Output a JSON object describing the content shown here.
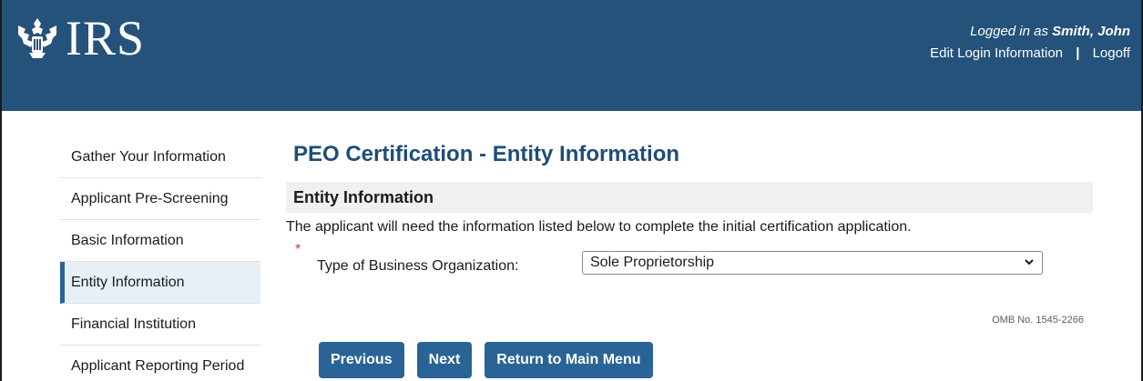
{
  "header": {
    "logo_text": "IRS",
    "logged_in_prefix": "Logged in as ",
    "user_name": "Smith, John",
    "edit_login_link": "Edit Login Information",
    "separator": "|",
    "logoff_link": "Logoff",
    "background_color": "#24527a"
  },
  "sidebar": {
    "items": [
      {
        "label": "Gather Your Information"
      },
      {
        "label": "Applicant Pre-Screening"
      },
      {
        "label": "Basic Information"
      },
      {
        "label": "Entity Information",
        "active": true
      },
      {
        "label": "Financial Institution"
      },
      {
        "label": "Applicant Reporting Period"
      }
    ]
  },
  "main": {
    "page_title": "PEO Certification - Entity Information",
    "section_title": "Entity Information",
    "intro_text": "The applicant will need the information listed below to complete the initial certification application.",
    "required_marker": "*",
    "field_label": "Type of Business Organization:",
    "field_value": "Sole Proprietorship",
    "omb_number": "OMB No. 1545-2266"
  },
  "buttons": {
    "previous": "Previous",
    "next": "Next",
    "return_main": "Return to Main Menu",
    "color": "#2a6496"
  },
  "icons": {
    "logo": "irs-eagle-icon",
    "select_arrow": "chevron-down-icon"
  }
}
